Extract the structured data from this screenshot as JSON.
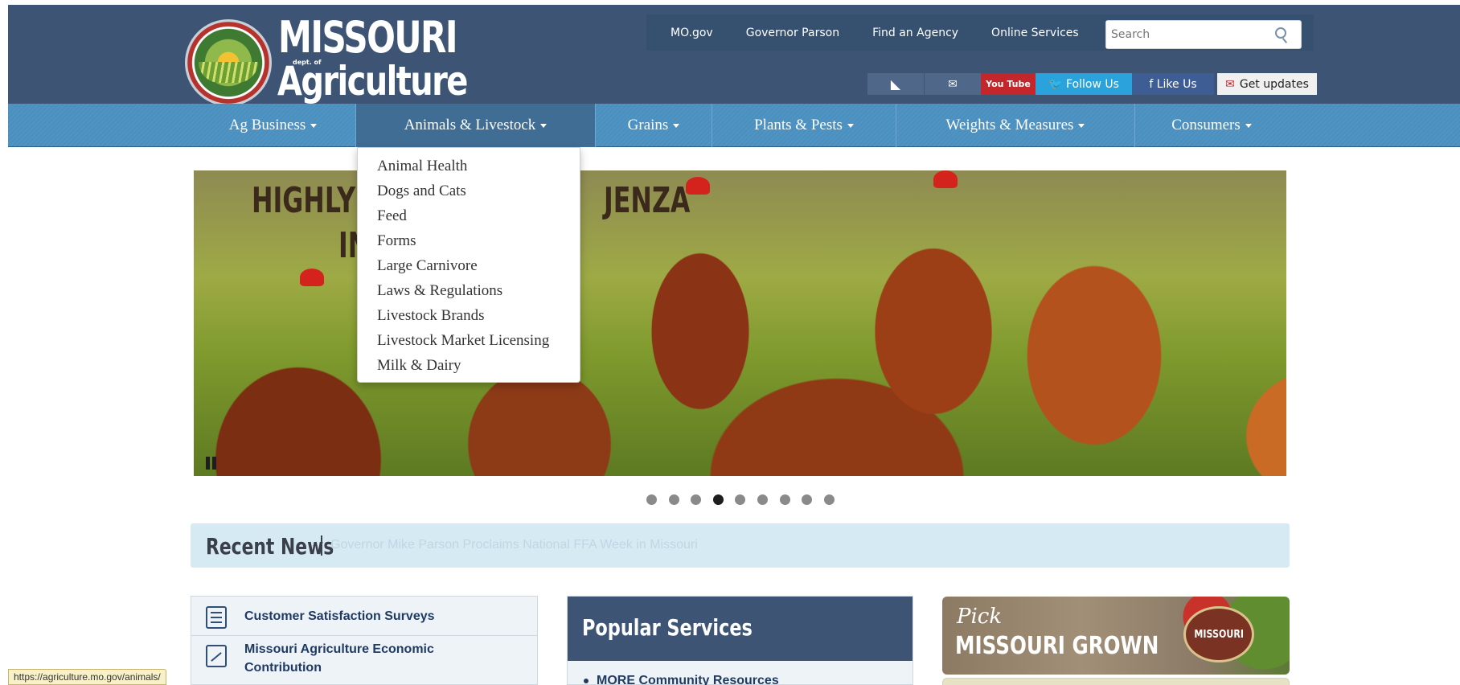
{
  "header": {
    "logo": {
      "line1": "MISSOURI",
      "dept": "dept. of",
      "line2": "Agriculture"
    },
    "utility_links": [
      "MO.gov",
      "Governor Parson",
      "Find an Agency",
      "Online Services"
    ],
    "search": {
      "placeholder": "Search",
      "value": ""
    },
    "social": {
      "rss": "◣",
      "mail": "✉",
      "youtube": "You Tube",
      "twitter": "🐦 Follow Us",
      "facebook": "f  Like Us",
      "updates_icon": "✉",
      "updates": "Get updates"
    },
    "colors": {
      "header_bg": "#3d5474",
      "nav_bg": "#4a8fbe",
      "youtube": "#c3262b",
      "twitter": "#2aa3dc",
      "facebook": "#3d5d94"
    }
  },
  "main_nav": {
    "items": [
      {
        "label": "Ag Business",
        "active": false
      },
      {
        "label": "Animals & Livestock",
        "active": true
      },
      {
        "label": "Grains",
        "active": false
      },
      {
        "label": "Plants & Pests",
        "active": false
      },
      {
        "label": "Weights & Measures",
        "active": false
      },
      {
        "label": "Consumers",
        "active": false
      }
    ]
  },
  "dropdown": {
    "parent": "Animals & Livestock",
    "items": [
      "Animal Health",
      "Dogs and Cats",
      "Feed",
      "Forms",
      "Large Carnivore",
      "Laws & Regulations",
      "Livestock Brands",
      "Livestock Market Licensing",
      "Milk & Dairy"
    ]
  },
  "hero": {
    "title_line1": "HIGHLY PA",
    "title_line1_end": "JENZA",
    "title_line2": "IN",
    "pause_icon": "pause-icon"
  },
  "carousel": {
    "total_slides": 9,
    "active_slide": 4
  },
  "news": {
    "label": "Recent News",
    "ticker": "Governor Mike Parson Proclaims National FFA Week in Missouri"
  },
  "quick_links": [
    {
      "icon": "clipboard-check-icon",
      "label": "Customer Satisfaction Surveys"
    },
    {
      "icon": "trend-chart-icon",
      "label": "Missouri Agriculture Economic Contribution"
    }
  ],
  "popular_services": {
    "title": "Popular Services",
    "items": [
      "MORE Community Resources"
    ]
  },
  "missouri_grown": {
    "pick": "Pick",
    "line": "MISSOURI GROWN",
    "seal": "MISSOURI"
  },
  "status_bar": {
    "url": "https://agriculture.mo.gov/animals/"
  }
}
